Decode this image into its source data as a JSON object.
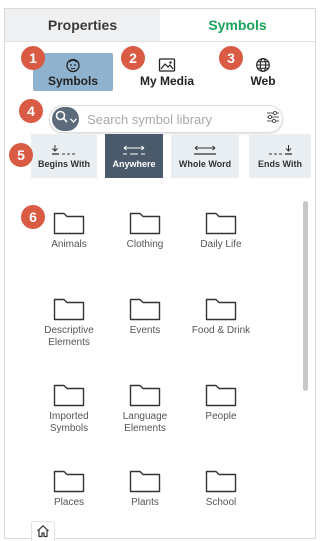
{
  "tabs": {
    "properties": "Properties",
    "symbols": "Symbols"
  },
  "sources": {
    "symbols": "Symbols",
    "my_media": "My Media",
    "web": "Web"
  },
  "search": {
    "placeholder": "Search symbol library"
  },
  "modes": {
    "begins_with": "Begins With",
    "anywhere": "Anywhere",
    "whole_word": "Whole Word",
    "ends_with": "Ends With",
    "active": "Anywhere"
  },
  "folders": [
    {
      "label": "Animals"
    },
    {
      "label": "Clothing"
    },
    {
      "label": "Daily Life"
    },
    {
      "label": "Descriptive Elements"
    },
    {
      "label": "Events"
    },
    {
      "label": "Food & Drink"
    },
    {
      "label": "Imported Symbols"
    },
    {
      "label": "Language Elements"
    },
    {
      "label": "People"
    },
    {
      "label": "Places"
    },
    {
      "label": "Plants"
    },
    {
      "label": "School"
    }
  ],
  "badges": [
    "1",
    "2",
    "3",
    "4",
    "5",
    "6"
  ],
  "colors": {
    "accent_green": "#1aa35a",
    "badge": "#d95b43",
    "selected_source": "#8fb3cf",
    "active_mode": "#4a5a6a",
    "mode_bg": "#e9eef3"
  }
}
